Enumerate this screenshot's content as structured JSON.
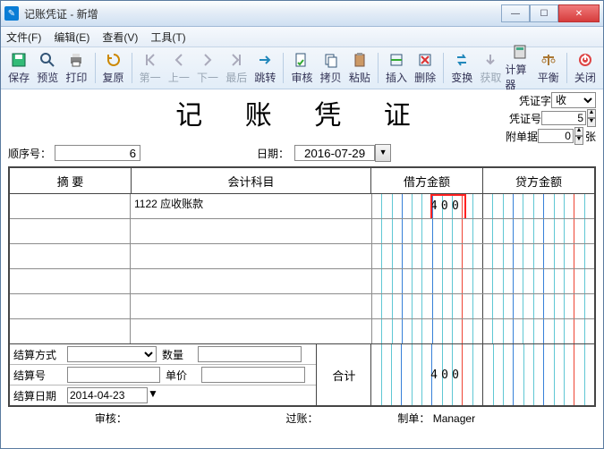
{
  "window": {
    "title": "记账凭证 - 新增"
  },
  "menu": {
    "file": "文件(F)",
    "edit": "编辑(E)",
    "view": "查看(V)",
    "tool": "工具(T)"
  },
  "toolbar": {
    "save": "保存",
    "preview": "预览",
    "print": "打印",
    "restore": "复原",
    "first": "第一",
    "prev": "上一",
    "next": "下一",
    "last": "最后",
    "jump": "跳转",
    "audit": "审核",
    "copy": "拷贝",
    "paste": "粘贴",
    "insert": "插入",
    "delete": "删除",
    "change": "变换",
    "fetch": "获取",
    "calc": "计算器",
    "balance": "平衡",
    "close": "关闭"
  },
  "heading": "记 账 凭 证",
  "right": {
    "voucher_word_label": "凭证字",
    "voucher_word_value": "收",
    "voucher_no_label": "凭证号",
    "voucher_no_value": "5",
    "attach_label": "附单据",
    "attach_value": "0",
    "attach_unit": "张"
  },
  "seq": {
    "label": "顺序号：",
    "value": "6",
    "date_label": "日期：",
    "date_value": "2016-07-29"
  },
  "grid": {
    "head": {
      "summary": "摘  要",
      "account": "会计科目",
      "debit": "借方金额",
      "credit": "贷方金额"
    },
    "rows": [
      {
        "summary": "",
        "account": "1122 应收账款",
        "debit": "400",
        "credit": "",
        "highlight": true
      },
      {
        "summary": "",
        "account": "",
        "debit": "",
        "credit": ""
      },
      {
        "summary": "",
        "account": "",
        "debit": "",
        "credit": ""
      },
      {
        "summary": "",
        "account": "",
        "debit": "",
        "credit": ""
      },
      {
        "summary": "",
        "account": "",
        "debit": "",
        "credit": ""
      },
      {
        "summary": "",
        "account": "",
        "debit": "",
        "credit": ""
      }
    ],
    "total_label": "合计",
    "total_debit": "400",
    "total_credit": ""
  },
  "settle": {
    "method_label": "结算方式",
    "qty_label": "数量",
    "no_label": "结算号",
    "price_label": "单价",
    "date_label": "结算日期",
    "date_value": "2014-04-23"
  },
  "footer": {
    "audit": "审核：",
    "post": "过账：",
    "maker_label": "制单：",
    "maker_value": "Manager"
  }
}
